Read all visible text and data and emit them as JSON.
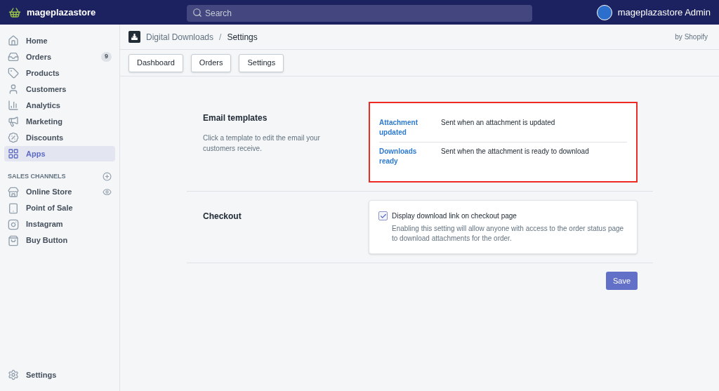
{
  "top_bar": {
    "store_name": "mageplazastore",
    "search": {
      "placeholder": "Search"
    },
    "account": "mageplazastore Admin"
  },
  "sidebar": {
    "items": [
      {
        "label": "Home",
        "selected": false
      },
      {
        "label": "Orders",
        "badge": "9",
        "selected": false
      },
      {
        "label": "Products",
        "selected": false
      },
      {
        "label": "Customers",
        "selected": false
      },
      {
        "label": "Analytics",
        "selected": false
      },
      {
        "label": "Marketing",
        "selected": false
      },
      {
        "label": "Discounts",
        "selected": false
      },
      {
        "label": "Apps",
        "selected": true
      }
    ],
    "sales_channels": {
      "heading": "SALES CHANNELS",
      "items": [
        {
          "label": "Online Store"
        },
        {
          "label": "Point of Sale"
        },
        {
          "label": "Instagram"
        },
        {
          "label": "Buy Button"
        }
      ]
    },
    "footer_item": "Settings"
  },
  "header": {
    "breadcrumb": "Digital Downloads",
    "separator": "/",
    "title": "Settings",
    "by": "by Shopify"
  },
  "tabs": [
    "Dashboard",
    "Orders",
    "Settings"
  ],
  "sections": [
    {
      "kind": "templates",
      "title": "Email templates",
      "description": "Click a template to edit the email your customers receive.",
      "highlighted": true,
      "templates": [
        {
          "name": "Attachment updated",
          "description": "Sent when an attachment is updated"
        },
        {
          "name": "Downloads ready",
          "description": "Sent when the attachment is ready to download"
        }
      ]
    },
    {
      "kind": "checkbox",
      "title": "Checkout",
      "label": "Display download link on checkout page",
      "checked": true,
      "help": "Enabling this setting will allow anyone with access to the order status page to download attachments for the order."
    }
  ],
  "save_button": "Save"
}
